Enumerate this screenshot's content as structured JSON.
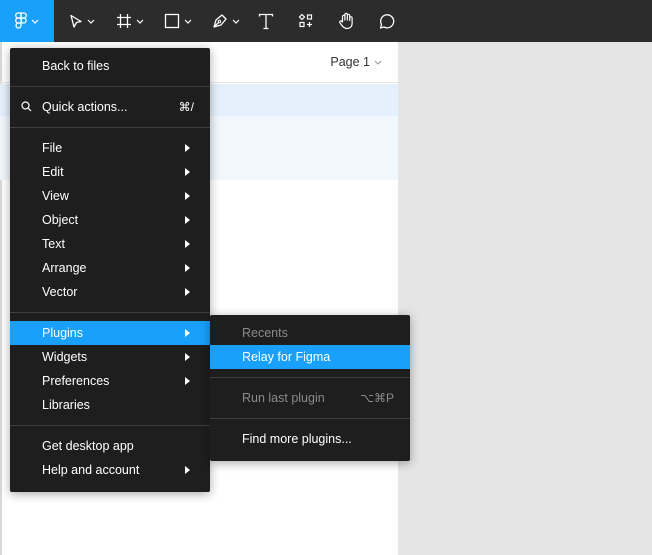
{
  "page_selector": {
    "label": "Page 1"
  },
  "toolbar": {
    "tools": [
      {
        "icon": "figma-logo-icon"
      },
      {
        "icon": "move-arrow-icon"
      },
      {
        "icon": "frame-hash-icon"
      },
      {
        "icon": "rectangle-icon"
      },
      {
        "icon": "pen-icon"
      },
      {
        "icon": "text-T-icon"
      },
      {
        "icon": "resources-icon"
      },
      {
        "icon": "hand-icon"
      },
      {
        "icon": "comment-icon"
      }
    ]
  },
  "main_menu": {
    "back_to_files": "Back to files",
    "quick_actions": {
      "label": "Quick actions...",
      "shortcut": "⌘/"
    },
    "file": "File",
    "edit": "Edit",
    "view": "View",
    "object": "Object",
    "text": "Text",
    "arrange": "Arrange",
    "vector": "Vector",
    "plugins": "Plugins",
    "widgets": "Widgets",
    "preferences": "Preferences",
    "libraries": "Libraries",
    "get_desktop_app": "Get desktop app",
    "help_and_account": "Help and account"
  },
  "plugins_submenu": {
    "recents": "Recents",
    "relay_for_figma": "Relay for Figma",
    "run_last_plugin": {
      "label": "Run last plugin",
      "shortcut": "⌥⌘P"
    },
    "find_more_plugins": "Find more plugins..."
  },
  "colors": {
    "toolbar_bg": "#2c2c2c",
    "accent": "#18a0fb",
    "menu_bg": "#1e1e1e",
    "canvas_bg": "#e5e5e5"
  }
}
